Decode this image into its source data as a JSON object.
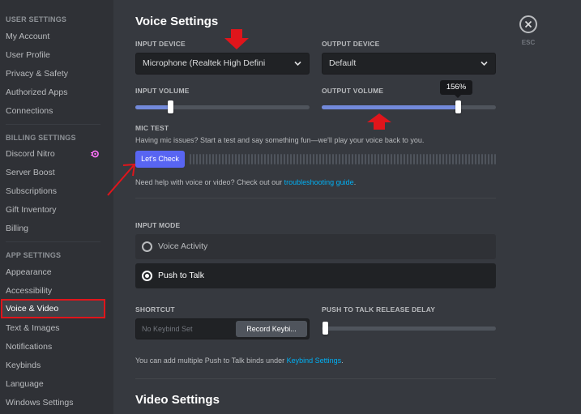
{
  "sidebar": {
    "user_settings": {
      "header": "USER SETTINGS",
      "items": [
        "My Account",
        "User Profile",
        "Privacy & Safety",
        "Authorized Apps",
        "Connections"
      ]
    },
    "billing_settings": {
      "header": "BILLING SETTINGS",
      "items": [
        "Discord Nitro",
        "Server Boost",
        "Subscriptions",
        "Gift Inventory",
        "Billing"
      ]
    },
    "app_settings": {
      "header": "APP SETTINGS",
      "items": [
        "Appearance",
        "Accessibility",
        "Voice & Video",
        "Text & Images",
        "Notifications",
        "Keybinds",
        "Language",
        "Windows Settings"
      ],
      "selected": "Voice & Video"
    }
  },
  "voice_settings": {
    "title": "Voice Settings",
    "input_device": {
      "label": "INPUT DEVICE",
      "value": "Microphone (Realtek High Defini"
    },
    "output_device": {
      "label": "OUTPUT DEVICE",
      "value": "Default"
    },
    "input_volume": {
      "label": "INPUT VOLUME",
      "level_fraction": 0.2
    },
    "output_volume": {
      "label": "OUTPUT VOLUME",
      "tooltip": "156%",
      "level_fraction": 0.78
    },
    "mic_test": {
      "label": "MIC TEST",
      "description": "Having mic issues? Start a test and say something fun—we'll play your voice back to you.",
      "button": "Let's Check"
    },
    "help": {
      "prefix": "Need help with voice or video? Check out our ",
      "link": "troubleshooting guide",
      "suffix": "."
    },
    "input_mode": {
      "label": "INPUT MODE",
      "options": [
        "Voice Activity",
        "Push to Talk"
      ],
      "selected": "Push to Talk"
    },
    "shortcut": {
      "label": "SHORTCUT",
      "placeholder": "No Keybind Set",
      "button": "Record Keybi..."
    },
    "ptt_delay": {
      "label": "PUSH TO TALK RELEASE DELAY",
      "level_fraction": 0.0
    },
    "keybind_note": {
      "prefix": "You can add multiple Push to Talk binds under ",
      "link": "Keybind Settings",
      "suffix": "."
    }
  },
  "video_settings": {
    "title": "Video Settings"
  },
  "close": {
    "label": "ESC"
  },
  "colors": {
    "accent": "#5865f2",
    "slider_fill": "#7289da",
    "annotation_red": "#e0151b",
    "link": "#00b0f4"
  }
}
